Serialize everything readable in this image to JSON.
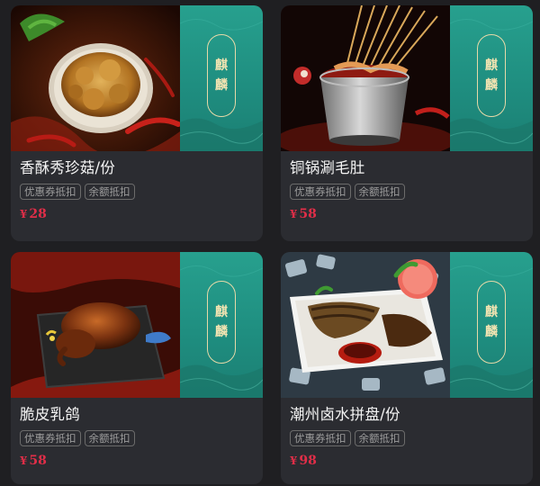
{
  "brand": {
    "chars": [
      "麒",
      "麟"
    ]
  },
  "currency_symbol": "¥",
  "products": [
    {
      "title": "香酥秀珍菇/份",
      "tags": [
        "优惠券抵扣",
        "余额抵扣"
      ],
      "price": "28",
      "image": "fried-mushroom"
    },
    {
      "title": "铜锅涮毛肚",
      "tags": [
        "优惠券抵扣",
        "余额抵扣"
      ],
      "price": "58",
      "image": "copper-pot-skewers"
    },
    {
      "title": "脆皮乳鸽",
      "tags": [
        "优惠券抵扣",
        "余额抵扣"
      ],
      "price": "58",
      "image": "crispy-pigeon"
    },
    {
      "title": "潮州卤水拼盘/份",
      "tags": [
        "优惠券抵扣",
        "余额抵扣"
      ],
      "price": "98",
      "image": "braised-platter"
    }
  ],
  "colors": {
    "background": "#1f1f22",
    "card": "#2b2c31",
    "brand_teal": "#23998a",
    "price_red": "#e02e48"
  }
}
